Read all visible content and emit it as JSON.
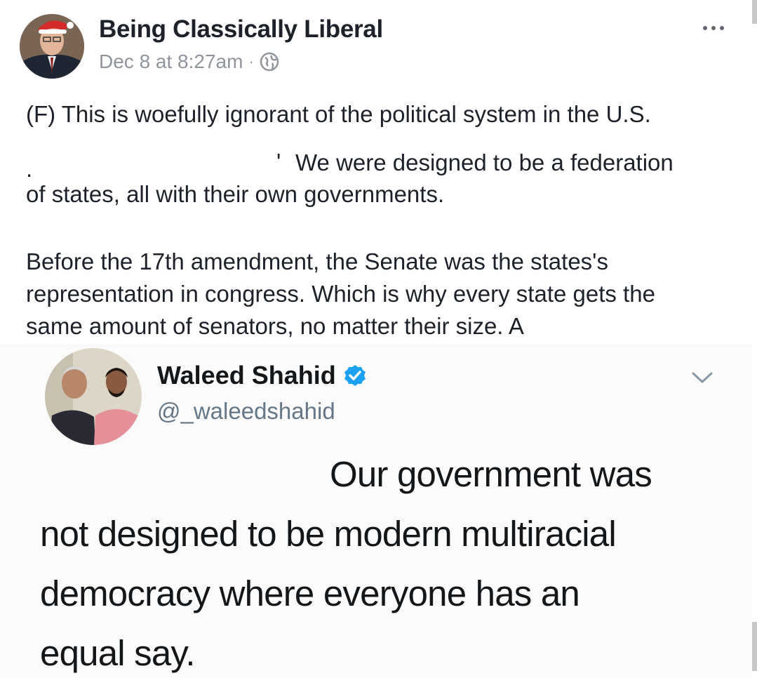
{
  "post": {
    "author": "Being Classically Liberal",
    "timestamp": "Dec 8 at 8:27am",
    "separator": "·",
    "privacy_icon": "globe-icon",
    "more_icon": "more-options-icon",
    "lines": [
      "(F) This is woefully ignorant of the political system in the U.S.",
      "We were designed to be a federation",
      "of states, all with their own governments.",
      "Before the 17th amendment, the Senate was the states's",
      "representation in congress. Which is why every state gets the",
      "same amount of senators, no matter their size. A"
    ],
    "redacted_marks": [
      ".",
      "'"
    ]
  },
  "tweet": {
    "name": "Waleed Shahid",
    "handle": "@_waleedshahid",
    "verified_icon": "verified-badge-icon",
    "menu_icon": "chevron-down-icon",
    "body_lines": [
      "Our government was",
      "not designed to be modern multiracial",
      "democracy where everyone has an",
      "equal say."
    ]
  },
  "colors": {
    "text": "#1d2129",
    "meta": "#90949c",
    "verified": "#1da1f2",
    "tweet_text": "#14171a",
    "handle": "#657786"
  }
}
